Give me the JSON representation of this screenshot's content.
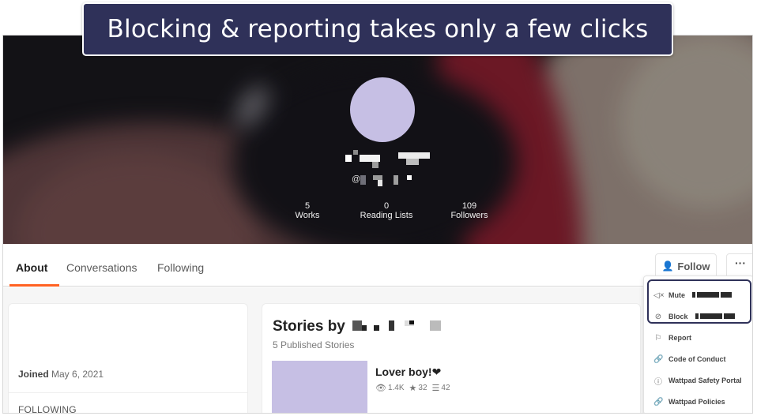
{
  "caption": {
    "text": "Blocking & reporting takes only a few clicks",
    "background": "#2f3159"
  },
  "profile": {
    "avatar_color": "#c6bfe4",
    "username_prefix": "@",
    "stats": [
      {
        "value": "5",
        "label": "Works"
      },
      {
        "value": "0",
        "label": "Reading Lists"
      },
      {
        "value": "109",
        "label": "Followers"
      }
    ]
  },
  "tabs": [
    {
      "label": "About",
      "active": true
    },
    {
      "label": "Conversations",
      "active": false
    },
    {
      "label": "Following",
      "active": false
    }
  ],
  "actions": {
    "follow_label": "Follow",
    "follow_icon": "add-user-icon",
    "more_label": "···"
  },
  "accent_color": "#ff6122",
  "about": {
    "joined_label": "Joined",
    "joined_date": "May 6, 2021",
    "following_heading": "FOLLOWING"
  },
  "stories": {
    "title_prefix": "Stories by",
    "subtitle": "5 Published Stories",
    "items": [
      {
        "title": "Lover boy!❤",
        "reads": "1.4K",
        "votes": "32",
        "parts": "42"
      }
    ]
  },
  "menu": {
    "items": [
      {
        "icon": "mute-icon",
        "glyph": "◁×",
        "label": "Mute"
      },
      {
        "icon": "block-icon",
        "glyph": "⊘",
        "label": "Block"
      },
      {
        "icon": "flag-icon",
        "glyph": "⚐",
        "label": "Report"
      },
      {
        "icon": "link-icon",
        "glyph": "🔗",
        "label": "Code of Conduct"
      },
      {
        "icon": "info-icon",
        "glyph": "ⓘ",
        "label": "Wattpad Safety Portal"
      },
      {
        "icon": "link-icon",
        "glyph": "🔗",
        "label": "Wattpad Policies"
      }
    ]
  }
}
